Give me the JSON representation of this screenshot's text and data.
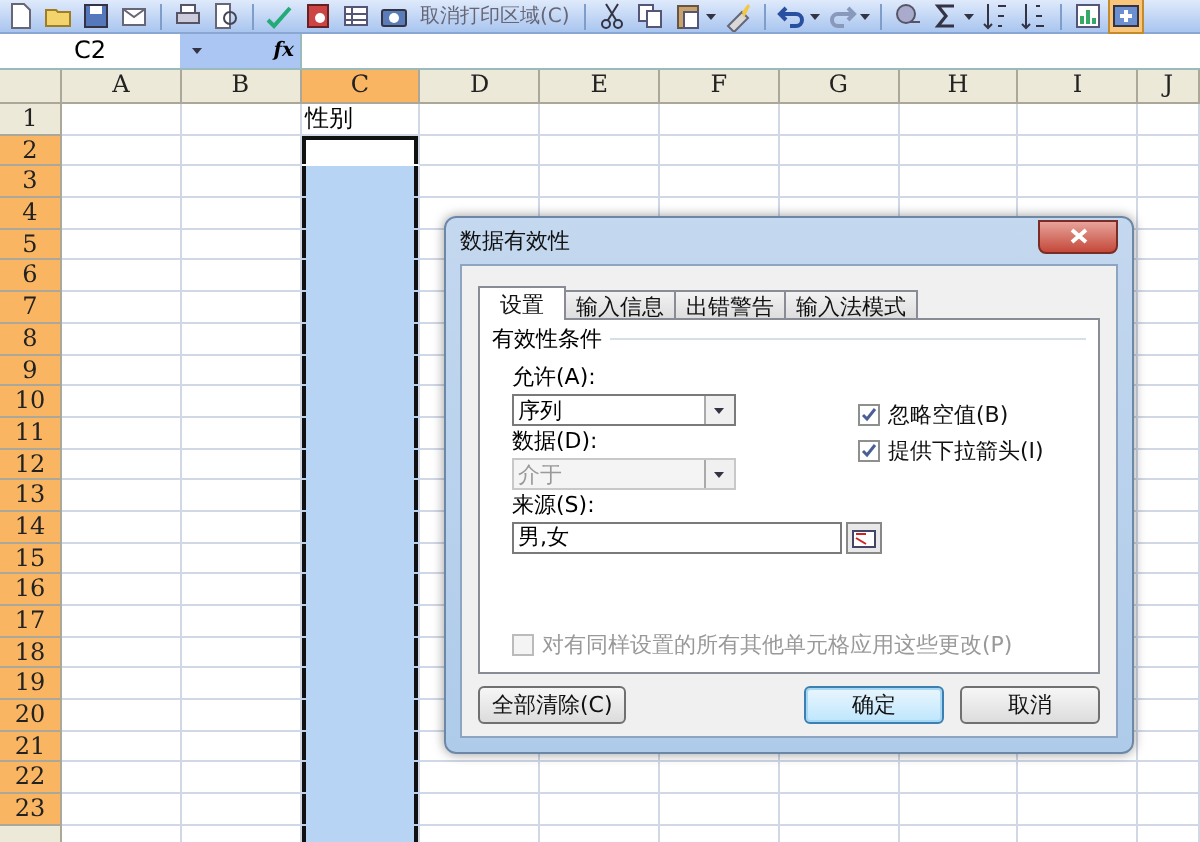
{
  "toolbar": {
    "print_area_button": "取消打印区域(C)"
  },
  "formula_bar": {
    "name_box": "C2",
    "fx_label": "fx"
  },
  "grid": {
    "columns": [
      {
        "label": "A",
        "selected": false
      },
      {
        "label": "B",
        "selected": false
      },
      {
        "label": "C",
        "selected": true
      },
      {
        "label": "D",
        "selected": false
      },
      {
        "label": "E",
        "selected": false
      },
      {
        "label": "F",
        "selected": false
      },
      {
        "label": "G",
        "selected": false
      },
      {
        "label": "H",
        "selected": false
      },
      {
        "label": "I",
        "selected": false
      },
      {
        "label": "J",
        "selected": false
      }
    ],
    "rows": [
      {
        "label": "1",
        "selected": false,
        "cells": [
          null,
          null,
          "性别"
        ]
      },
      {
        "label": "2",
        "selected": true
      },
      {
        "label": "3",
        "selected": true
      },
      {
        "label": "4",
        "selected": true
      },
      {
        "label": "5",
        "selected": true
      },
      {
        "label": "6",
        "selected": true
      },
      {
        "label": "7",
        "selected": true
      },
      {
        "label": "8",
        "selected": true
      },
      {
        "label": "9",
        "selected": true
      },
      {
        "label": "10",
        "selected": true
      },
      {
        "label": "11",
        "selected": true
      },
      {
        "label": "12",
        "selected": true
      },
      {
        "label": "13",
        "selected": true
      },
      {
        "label": "14",
        "selected": true
      },
      {
        "label": "15",
        "selected": true
      },
      {
        "label": "16",
        "selected": true
      },
      {
        "label": "17",
        "selected": true
      },
      {
        "label": "18",
        "selected": true
      },
      {
        "label": "19",
        "selected": true
      },
      {
        "label": "20",
        "selected": true
      },
      {
        "label": "21",
        "selected": true
      },
      {
        "label": "22",
        "selected": true
      },
      {
        "label": "23",
        "selected": true
      }
    ]
  },
  "dialog": {
    "title": "数据有效性",
    "tabs": [
      {
        "label": "设置",
        "selected": true
      },
      {
        "label": "输入信息",
        "selected": false
      },
      {
        "label": "出错警告",
        "selected": false
      },
      {
        "label": "输入法模式",
        "selected": false
      }
    ],
    "group_label": "有效性条件",
    "allow_label": "允许(A):",
    "allow_dropdown": {
      "value": "序列",
      "disabled": false
    },
    "data_label": "数据(D):",
    "data_dropdown": {
      "value": "介于",
      "disabled": true
    },
    "source_label": "来源(S):",
    "source_value": "男,女",
    "checkboxes": [
      {
        "label": "忽略空值(B)",
        "checked": true,
        "disabled": false
      },
      {
        "label": "提供下拉箭头(I)",
        "checked": true,
        "disabled": false
      }
    ],
    "apply_all": {
      "label": "对有同样设置的所有其他单元格应用这些更改(P)",
      "checked": false,
      "disabled": true
    },
    "buttons": [
      {
        "label": "全部清除(C)",
        "default": false
      },
      {
        "label": "确定",
        "default": true
      },
      {
        "label": "取消",
        "default": false
      }
    ]
  }
}
